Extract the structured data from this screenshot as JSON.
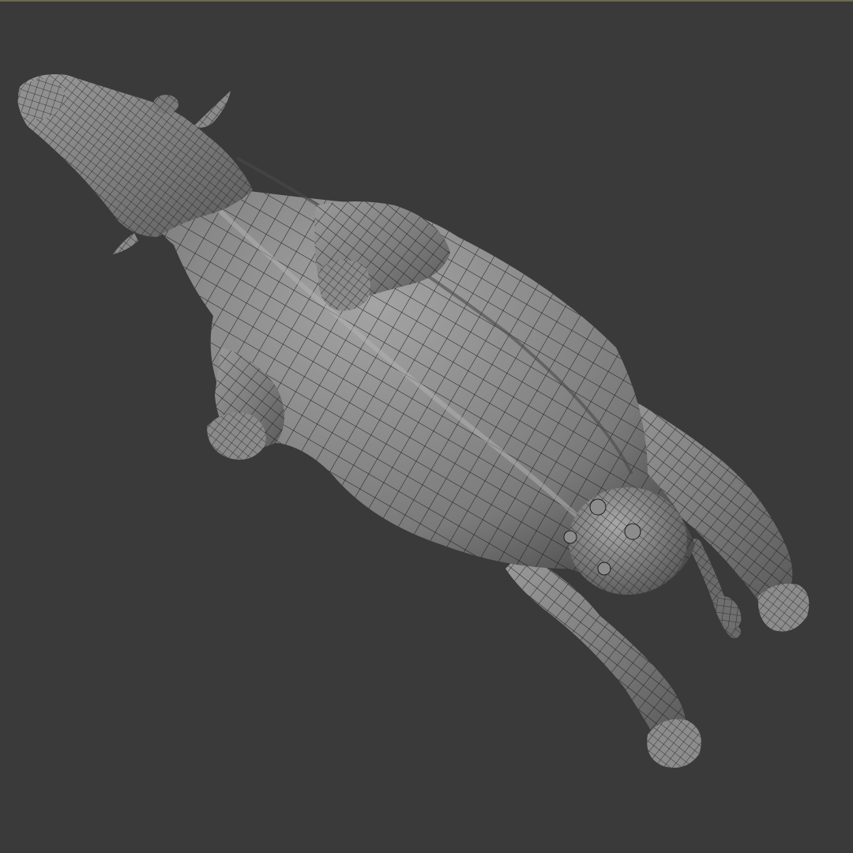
{
  "viewport": {
    "background_color": "#3a3a3a",
    "top_edge_color": "#6b6a4e",
    "display_mode": "wireframe-on-shaded"
  },
  "model": {
    "subject": "cow",
    "view": "underside",
    "surface_color": "#8a8a8a",
    "wire_color": "#1c1c1c",
    "parts": [
      "head",
      "horn",
      "ear",
      "neck",
      "torso",
      "front-leg",
      "hind-leg",
      "udder",
      "teat",
      "tail",
      "hoof"
    ]
  }
}
